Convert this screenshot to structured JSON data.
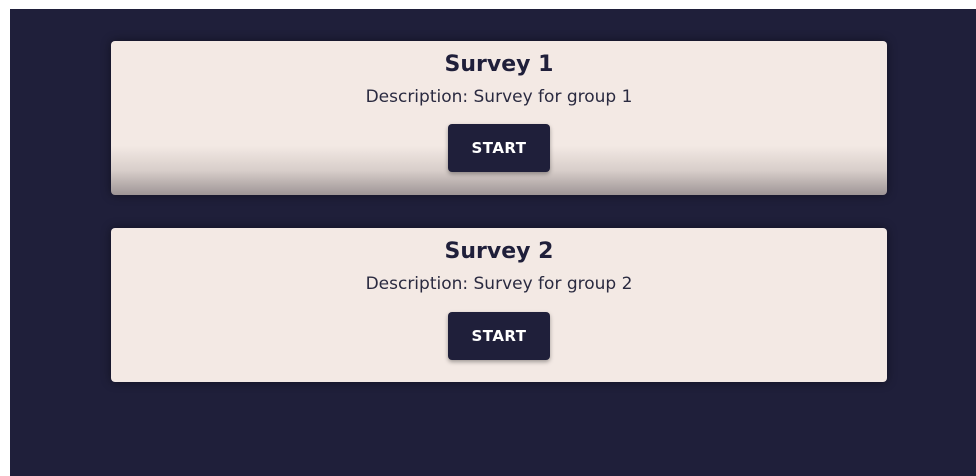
{
  "colors": {
    "background": "#1f1f3a",
    "card": "#f3e9e4",
    "button": "#1f1f3a",
    "button_text": "#ffffff"
  },
  "surveys": [
    {
      "title": "Survey 1",
      "description": "Description: Survey for group 1",
      "button_label": "START"
    },
    {
      "title": "Survey 2",
      "description": "Description: Survey for group 2",
      "button_label": "START"
    }
  ]
}
